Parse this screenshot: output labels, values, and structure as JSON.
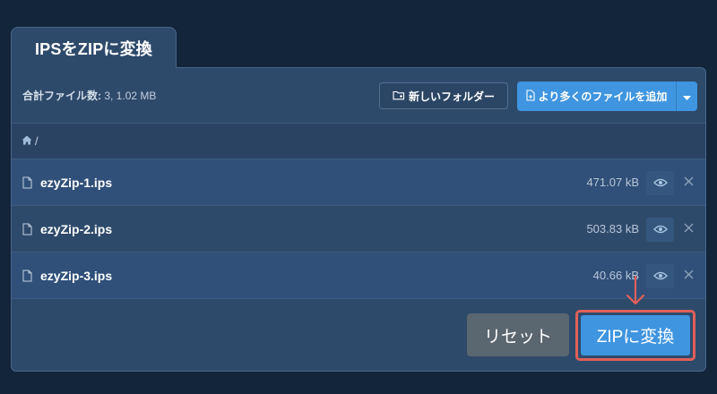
{
  "tab": {
    "title": "IPSをZIPに変換"
  },
  "toolbar": {
    "summary_label": "合計ファイル数:",
    "summary_value": "3, 1.02 MB",
    "new_folder_label": "新しいフォルダー",
    "add_files_label": "より多くのファイルを追加"
  },
  "breadcrumb": {
    "path": "/"
  },
  "files": [
    {
      "name": "ezyZip-1.ips",
      "size": "471.07 kB"
    },
    {
      "name": "ezyZip-2.ips",
      "size": "503.83 kB"
    },
    {
      "name": "ezyZip-3.ips",
      "size": "40.66 kB"
    }
  ],
  "actions": {
    "reset_label": "リセット",
    "convert_label": "ZIPに変換"
  },
  "icons": {
    "folder": "folder-plus-icon",
    "add": "file-plus-icon",
    "caret": "caret-down-icon",
    "home": "home-icon",
    "file": "file-icon",
    "eye": "eye-icon",
    "close": "close-icon",
    "arrow": "arrow-down-icon"
  },
  "colors": {
    "background": "#13253a",
    "panel": "#2e4a6b",
    "accent": "#3f95e0",
    "reset": "#5a6670",
    "highlight": "#e0605a"
  }
}
